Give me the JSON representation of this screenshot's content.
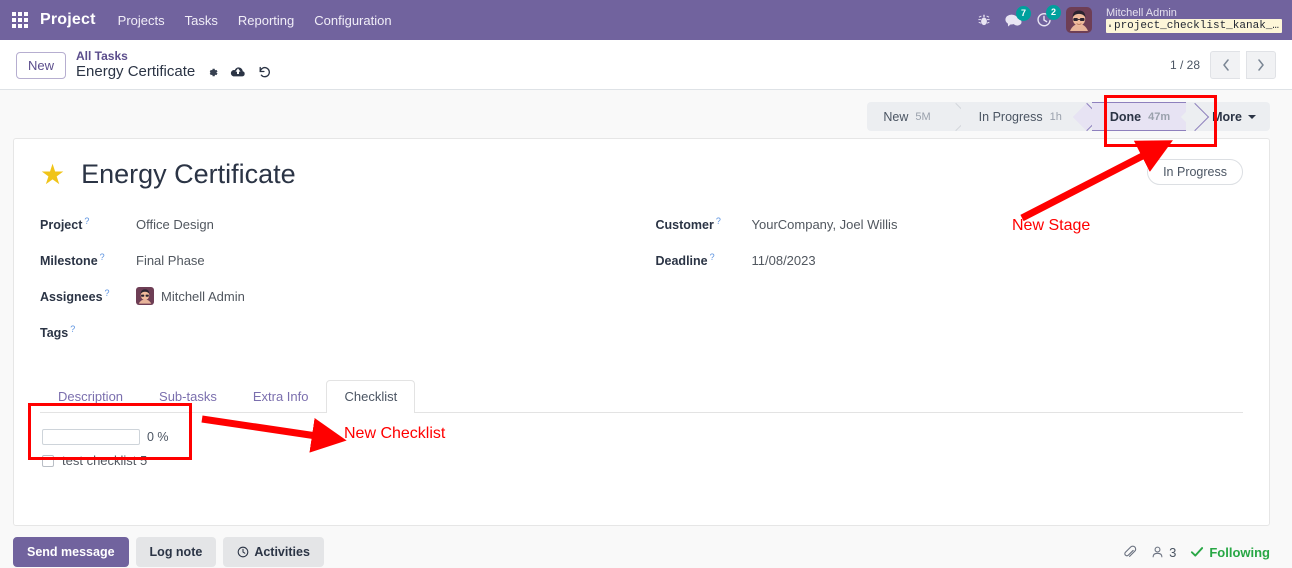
{
  "navbar": {
    "apps_icon": "apps-grid-icon",
    "brand": "Project",
    "menu": [
      {
        "label": "Projects"
      },
      {
        "label": "Tasks"
      },
      {
        "label": "Reporting"
      },
      {
        "label": "Configuration"
      }
    ],
    "bug_icon": "bug-icon",
    "messages_icon": "messages-icon",
    "messages_count": "7",
    "activities_icon": "clock-icon",
    "activities_count": "2",
    "avatar_icon": "user-avatar",
    "user_name": "Mitchell Admin",
    "database_icon": "database-icon",
    "database_name": "project_checklist_kanak_…"
  },
  "control_panel": {
    "new_button": "New",
    "breadcrumb_parent": "All Tasks",
    "breadcrumb_current": "Energy Certificate",
    "gear_icon": "gear-icon",
    "save_icon": "cloud-upload-icon",
    "discard_icon": "undo-icon",
    "pager": "1 / 28",
    "prev_icon": "chevron-left-icon",
    "next_icon": "chevron-right-icon"
  },
  "statusbar": {
    "stages": [
      {
        "label": "New",
        "duration": "5M",
        "active": false
      },
      {
        "label": "In Progress",
        "duration": "1h",
        "active": false
      },
      {
        "label": "Done",
        "duration": "47m",
        "active": true
      }
    ],
    "more_label": "More"
  },
  "form": {
    "star_icon": "favorite-star-icon",
    "title": "Energy Certificate",
    "state_pill": "In Progress",
    "left_fields": [
      {
        "label": "Project",
        "help": "?",
        "value": "Office Design"
      },
      {
        "label": "Milestone",
        "help": "?",
        "value": "Final Phase"
      },
      {
        "label": "Assignees",
        "help": "?",
        "value": "Mitchell Admin"
      },
      {
        "label": "Tags",
        "help": "?",
        "value": ""
      }
    ],
    "right_fields": [
      {
        "label": "Customer",
        "help": "?",
        "value": "YourCompany, Joel Willis"
      },
      {
        "label": "Deadline",
        "help": "?",
        "value": "11/08/2023"
      }
    ]
  },
  "notebook": {
    "tabs": [
      {
        "label": "Description",
        "active": false
      },
      {
        "label": "Sub-tasks",
        "active": false
      },
      {
        "label": "Extra Info",
        "active": false
      },
      {
        "label": "Checklist",
        "active": true
      }
    ],
    "checklist": {
      "progress_percent": 0,
      "progress_label": "0 %",
      "items": [
        {
          "label": "test checklist 5",
          "checked": false
        }
      ]
    }
  },
  "chatter": {
    "send_message": "Send message",
    "log_note": "Log note",
    "activities_icon": "clock-icon",
    "activities": "Activities",
    "attachment_icon": "paperclip-icon",
    "followers_icon": "user-icon",
    "followers_count": "3",
    "check_icon": "check-icon",
    "following": "Following"
  },
  "annotations": {
    "color": "#ff0000",
    "items": [
      {
        "text": "New Stage",
        "target": "done-stage"
      },
      {
        "text": "New Checklist",
        "target": "checklist-box"
      }
    ]
  }
}
